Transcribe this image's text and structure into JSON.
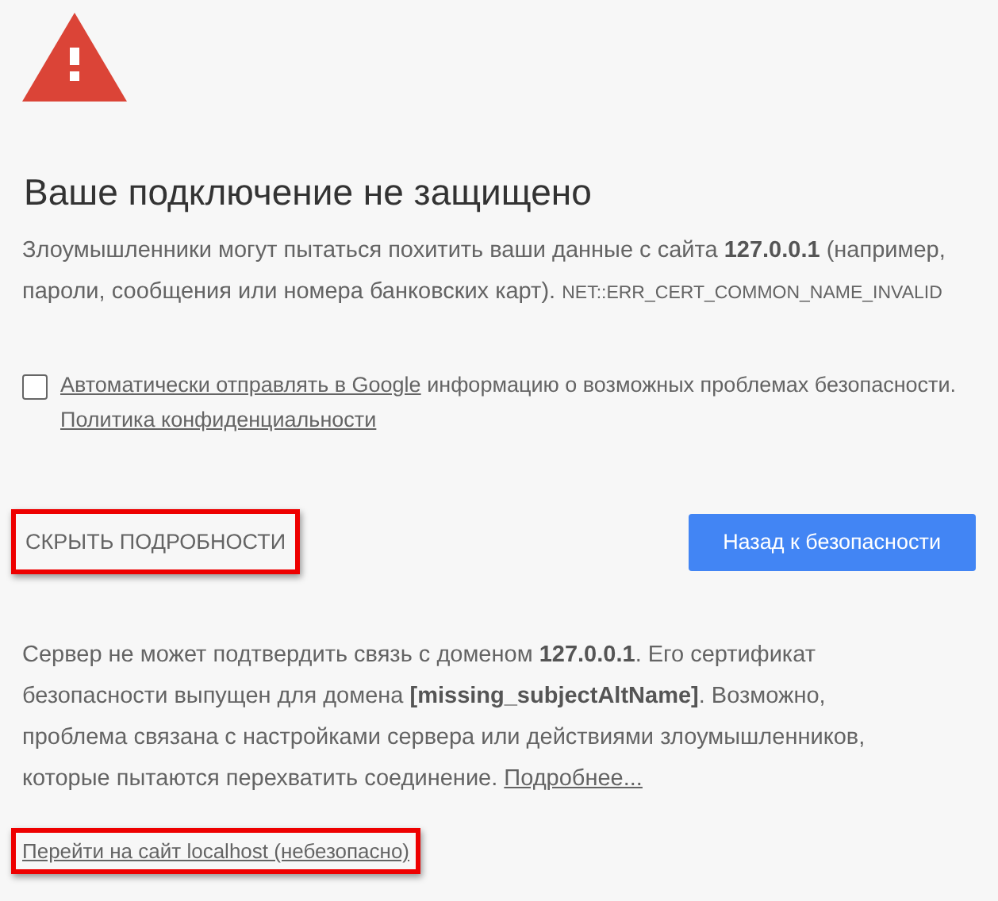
{
  "heading": "Ваше подключение не защищено",
  "intro": {
    "text": "Злоумышленники могут пытаться похитить ваши данные с сайта **127.0.0.1** (например, пароли, сообщения или номера банковских карт).",
    "error_code": "NET::ERR_CERT_COMMON_NAME_INVALID"
  },
  "report": {
    "checked": false,
    "link": "Автоматически отправлять в Google",
    "text": "информацию о возможных проблемах безопасности.",
    "policy_link": "Политика конфиденциальности"
  },
  "details_button": {
    "label": "СКРЫТЬ ПОДРОБНОСТИ",
    "highlighted": true
  },
  "back_button": {
    "label": "Назад к безопасности"
  },
  "details": {
    "text": "Сервер не может подтвердить связь с доменом **127.0.0.1**. Его сертификат безопасности выпущен для домена **[missing_subjectAltName]**. Возможно, проблема связана с настройками сервера или действиями злоумышленников, которые пытаются перехватить соединение.",
    "link": "Подробнее..."
  },
  "proceed_link": {
    "label": "Перейти на сайт localhost (небезопасно)",
    "highlighted": true
  }
}
